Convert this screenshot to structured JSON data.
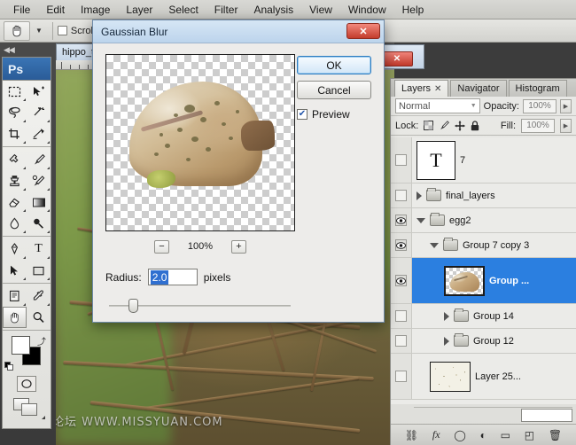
{
  "menubar": {
    "items": [
      "File",
      "Edit",
      "Image",
      "Layer",
      "Select",
      "Filter",
      "Analysis",
      "View",
      "Window",
      "Help"
    ]
  },
  "options_bar": {
    "tool_icon": "hand-tool-icon",
    "scroll_label": "Scroll",
    "scroll_checked": false
  },
  "toolbox": {
    "logo": "Ps",
    "tools": [
      {
        "name": "marquee-tool",
        "glyph": "marquee"
      },
      {
        "name": "move-tool",
        "glyph": "move"
      },
      {
        "name": "lasso-tool",
        "glyph": "lasso"
      },
      {
        "name": "magic-wand-tool",
        "glyph": "wand"
      },
      {
        "name": "crop-tool",
        "glyph": "crop"
      },
      {
        "name": "slice-tool",
        "glyph": "slice"
      },
      {
        "name": "healing-brush-tool",
        "glyph": "heal"
      },
      {
        "name": "brush-tool",
        "glyph": "brush"
      },
      {
        "name": "clone-stamp-tool",
        "glyph": "stamp"
      },
      {
        "name": "history-brush-tool",
        "glyph": "history"
      },
      {
        "name": "eraser-tool",
        "glyph": "eraser"
      },
      {
        "name": "gradient-tool",
        "glyph": "gradient"
      },
      {
        "name": "blur-tool",
        "glyph": "blur"
      },
      {
        "name": "dodge-tool",
        "glyph": "dodge"
      },
      {
        "name": "pen-tool",
        "glyph": "pen"
      },
      {
        "name": "type-tool",
        "glyph": "T"
      },
      {
        "name": "path-selection-tool",
        "glyph": "arrow"
      },
      {
        "name": "shape-tool",
        "glyph": "shape"
      },
      {
        "name": "notes-tool",
        "glyph": "note"
      },
      {
        "name": "eyedropper-tool",
        "glyph": "eyedropper"
      },
      {
        "name": "hand-tool",
        "glyph": "hand",
        "selected": true
      },
      {
        "name": "zoom-tool",
        "glyph": "zoom"
      }
    ],
    "foreground_color": "#ffffff",
    "background_color": "#000000"
  },
  "document": {
    "tab_label": "hippo_t",
    "watermark": "思缘设计论坛 WWW.MISSYUAN.COM"
  },
  "dialog": {
    "title": "Gaussian Blur",
    "close_glyph": "✕",
    "ok_label": "OK",
    "cancel_label": "Cancel",
    "preview_label": "Preview",
    "preview_checked": true,
    "check_glyph": "✔",
    "zoom_out": "−",
    "zoom_in": "+",
    "zoom_level": "100%",
    "radius_label": "Radius:",
    "radius_value": "2.0",
    "radius_unit": "pixels"
  },
  "panel": {
    "tabs": [
      {
        "label": "Layers",
        "active": true,
        "has_close": true
      },
      {
        "label": "Navigator",
        "active": false,
        "has_close": false
      },
      {
        "label": "Histogram",
        "active": false,
        "has_close": false
      }
    ],
    "close_glyph": "✕",
    "blend_mode": "Normal",
    "opacity_label": "Opacity:",
    "opacity_value": "100%",
    "lock_label": "Lock:",
    "fill_label": "Fill:",
    "fill_value": "100%",
    "stepper_glyph": "▶",
    "selected_color": "#2b7fe0",
    "layers": [
      {
        "name": "7",
        "type": "text",
        "visible": false,
        "indent": 0,
        "thumb": "T",
        "disclosure": null
      },
      {
        "name": "final_layers",
        "type": "group",
        "visible": false,
        "indent": 0,
        "disclosure": "closed"
      },
      {
        "name": "egg2",
        "type": "group",
        "visible": true,
        "indent": 0,
        "disclosure": "open"
      },
      {
        "name": "Group 7 copy 3",
        "type": "group",
        "visible": true,
        "indent": 1,
        "disclosure": "open"
      },
      {
        "name": "Group ...",
        "type": "image",
        "visible": true,
        "indent": 2,
        "selected": true,
        "thumb": "shell"
      },
      {
        "name": "Group 14",
        "type": "group",
        "visible": false,
        "indent": 2,
        "disclosure": "closed"
      },
      {
        "name": "Group 12",
        "type": "group",
        "visible": false,
        "indent": 2,
        "disclosure": "closed"
      },
      {
        "name": "Layer 25...",
        "type": "image",
        "visible": false,
        "indent": 1,
        "thumb": "speckle"
      }
    ],
    "footer_icons": [
      {
        "name": "link-layers-icon",
        "glyph": "⛓"
      },
      {
        "name": "layer-style-fx-icon",
        "glyph": "fx"
      },
      {
        "name": "layer-mask-icon",
        "glyph": "◯"
      },
      {
        "name": "adjustment-layer-icon",
        "glyph": "◐"
      },
      {
        "name": "new-group-icon",
        "glyph": "▭"
      },
      {
        "name": "new-layer-icon",
        "glyph": "◰"
      },
      {
        "name": "delete-layer-icon",
        "glyph": "🗑"
      }
    ]
  }
}
